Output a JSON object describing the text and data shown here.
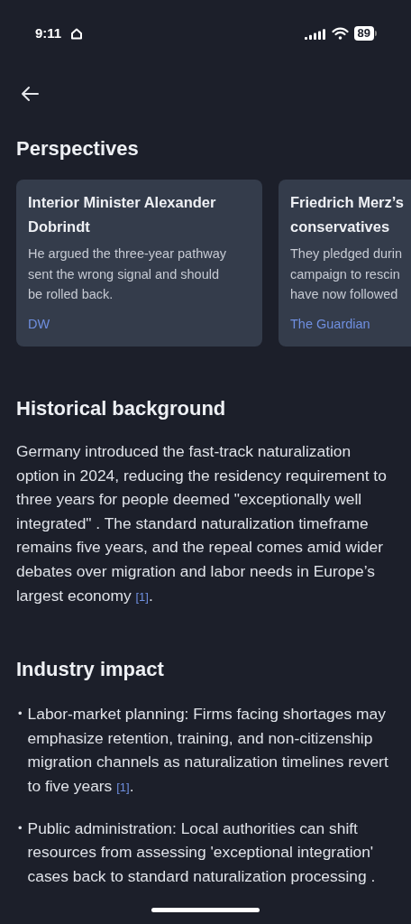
{
  "status_bar": {
    "time": "9:11",
    "battery": "89"
  },
  "perspectives": {
    "title": "Perspectives",
    "cards": [
      {
        "title_lines": [
          "Interior Minister Alexander",
          "Dobrindt"
        ],
        "body_lines": [
          "He argued the three-year pathway",
          "sent the wrong signal and should",
          "be rolled back."
        ],
        "source": "DW"
      },
      {
        "title_lines": [
          "Friedrich Merz’s",
          "conservatives"
        ],
        "body_lines": [
          "They pledged durin",
          "campaign to rescin",
          "have now followed"
        ],
        "source": "The Guardian"
      }
    ]
  },
  "background": {
    "title": "Historical background",
    "text": "Germany introduced the fast-track naturalization option in 2024, reducing the residency requirement to three years for people deemed \"exceptionally well integrated\" . The standard naturalization timeframe remains five years, and the repeal comes amid wider debates over migration and labor needs in Europe’s largest economy",
    "citation": "[1]",
    "end": "."
  },
  "impact": {
    "title": "Industry impact",
    "items": [
      {
        "bullet": "•",
        "text": "Labor-market planning: Firms facing shortages may emphasize retention, training, and non-citizenship migration channels as naturalization timelines revert to five years",
        "citation": "[1]",
        "end": "."
      },
      {
        "bullet": "•",
        "text": "Public administration: Local authorities can shift resources from assessing 'exceptional integration' cases back to standard naturalization processing ."
      }
    ]
  }
}
